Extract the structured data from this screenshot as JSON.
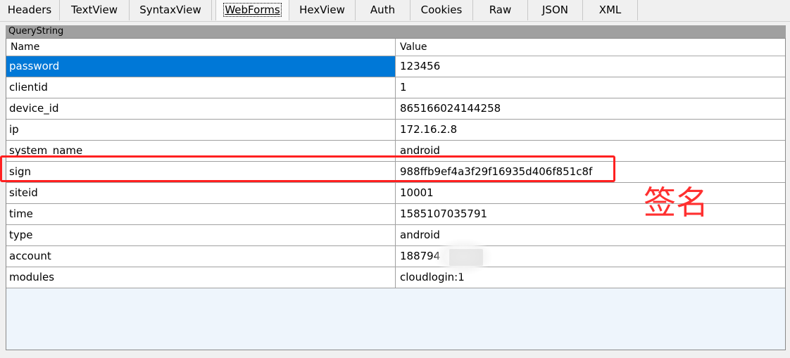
{
  "tabs": [
    {
      "label": "Headers",
      "active": false
    },
    {
      "label": "TextView",
      "active": false
    },
    {
      "label": "SyntaxView",
      "active": false
    },
    {
      "label": "WebForms",
      "active": true
    },
    {
      "label": "HexView",
      "active": false
    },
    {
      "label": "Auth",
      "active": false
    },
    {
      "label": "Cookies",
      "active": false
    },
    {
      "label": "Raw",
      "active": false
    },
    {
      "label": "JSON",
      "active": false
    },
    {
      "label": "XML",
      "active": false
    }
  ],
  "section": {
    "title": "QueryString"
  },
  "grid": {
    "columns": {
      "name": "Name",
      "value": "Value"
    },
    "rows": [
      {
        "name": "password",
        "value": "123456",
        "selected": true
      },
      {
        "name": "clientid",
        "value": "1"
      },
      {
        "name": "device_id",
        "value": "865166024144258"
      },
      {
        "name": "ip",
        "value": "172.16.2.8"
      },
      {
        "name": "system_name",
        "value": "android"
      },
      {
        "name": "sign",
        "value": "988ffb9ef4a3f29f16935d406f851c8f"
      },
      {
        "name": "siteid",
        "value": "10001"
      },
      {
        "name": "time",
        "value": "1585107035791"
      },
      {
        "name": "type",
        "value": "android"
      },
      {
        "name": "account",
        "value": "188794"
      },
      {
        "name": "modules",
        "value": "cloudlogin:1"
      }
    ]
  },
  "annotation": {
    "text": "签名",
    "color": "#ff3030"
  },
  "colors": {
    "selection": "#0078d7",
    "highlight": "#ff2020",
    "grid_bg": "#eef5fc"
  }
}
